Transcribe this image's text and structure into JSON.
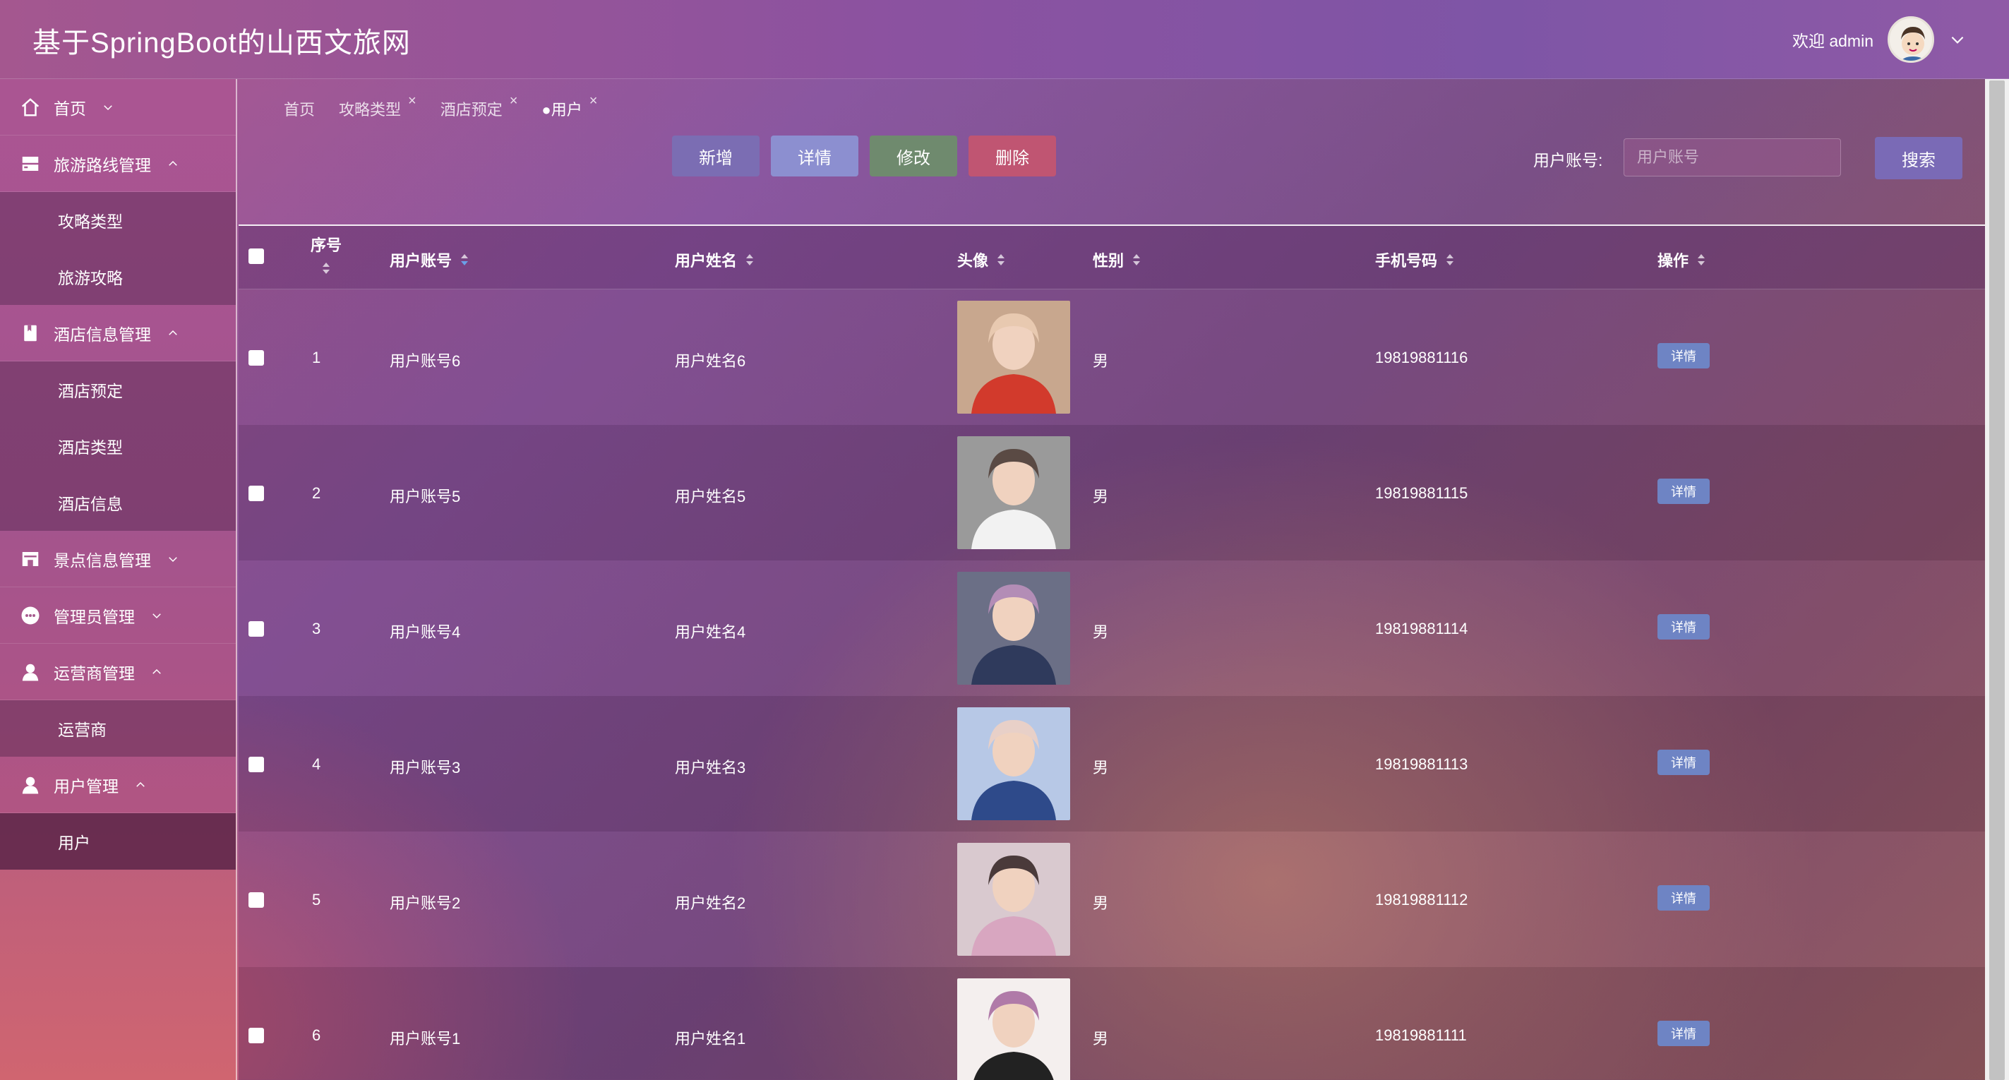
{
  "header": {
    "title": "基于SpringBoot的山西文旅网",
    "welcome": "欢迎 admin"
  },
  "sidebar": {
    "items": [
      {
        "label": "首页",
        "icon": "home-icon",
        "expanded": false,
        "children": []
      },
      {
        "label": "旅游路线管理",
        "icon": "route-icon",
        "expanded": true,
        "children": [
          "攻略类型",
          "旅游攻略"
        ]
      },
      {
        "label": "酒店信息管理",
        "icon": "hotel-icon",
        "expanded": true,
        "children": [
          "酒店预定",
          "酒店类型",
          "酒店信息"
        ]
      },
      {
        "label": "景点信息管理",
        "icon": "scenic-icon",
        "expanded": false,
        "children": []
      },
      {
        "label": "管理员管理",
        "icon": "admin-icon",
        "expanded": false,
        "children": []
      },
      {
        "label": "运营商管理",
        "icon": "operator-icon",
        "expanded": true,
        "children": [
          "运营商"
        ]
      },
      {
        "label": "用户管理",
        "icon": "user-icon",
        "expanded": true,
        "children": [
          "用户"
        ]
      }
    ],
    "active_child": "用户"
  },
  "tabs": [
    {
      "label": "首页",
      "closable": false
    },
    {
      "label": "攻略类型",
      "closable": true
    },
    {
      "label": "酒店预定",
      "closable": true
    },
    {
      "label": "●用户",
      "closable": true,
      "active": true
    }
  ],
  "toolbar": {
    "add_label": "新增",
    "detail_label": "详情",
    "edit_label": "修改",
    "delete_label": "删除"
  },
  "search": {
    "label": "用户账号:",
    "placeholder": "用户账号",
    "button_label": "搜索"
  },
  "table": {
    "columns": [
      "序号",
      "用户账号",
      "用户姓名",
      "头像",
      "性别",
      "手机号码",
      "操作"
    ],
    "rows": [
      {
        "index": "1",
        "account": "用户账号6",
        "name": "用户姓名6",
        "gender": "男",
        "phone": "19819881116",
        "action": "详情"
      },
      {
        "index": "2",
        "account": "用户账号5",
        "name": "用户姓名5",
        "gender": "男",
        "phone": "19819881115",
        "action": "详情"
      },
      {
        "index": "3",
        "account": "用户账号4",
        "name": "用户姓名4",
        "gender": "男",
        "phone": "19819881114",
        "action": "详情"
      },
      {
        "index": "4",
        "account": "用户账号3",
        "name": "用户姓名3",
        "gender": "男",
        "phone": "19819881113",
        "action": "详情"
      },
      {
        "index": "5",
        "account": "用户账号2",
        "name": "用户姓名2",
        "gender": "男",
        "phone": "19819881112",
        "action": "详情"
      },
      {
        "index": "6",
        "account": "用户账号1",
        "name": "用户姓名1",
        "gender": "男",
        "phone": "19819881111",
        "action": "详情"
      }
    ]
  },
  "colors": {
    "add": "#7b6db3",
    "detail": "#8c8fd0",
    "edit": "#6f8a6e",
    "delete": "#c05572",
    "row_detail": "#6e84c4"
  }
}
